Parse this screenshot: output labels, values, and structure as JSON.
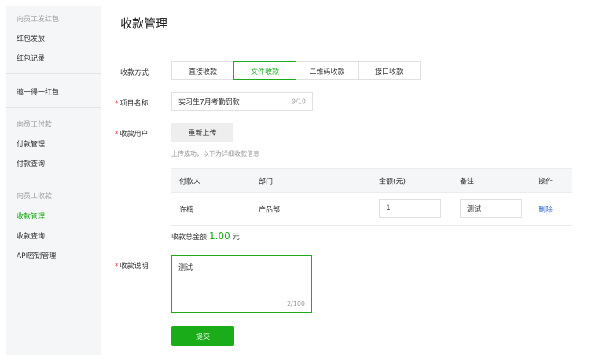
{
  "sidebar": {
    "groups": [
      {
        "title": "向员工发红包",
        "items": [
          "红包发放",
          "红包记录"
        ]
      },
      {
        "title": "",
        "items": [
          "邀一得一红包"
        ]
      },
      {
        "title": "向员工付款",
        "items": [
          "付款管理",
          "付款查询"
        ]
      },
      {
        "title": "向员工收款",
        "items": [
          "收款管理",
          "收款查询",
          "API密钥管理"
        ]
      }
    ]
  },
  "page": {
    "title": "收款管理"
  },
  "form": {
    "method_label": "收款方式",
    "tabs": [
      "直接收款",
      "文件收款",
      "二维码收款",
      "接口收款"
    ],
    "active_tab": "文件收款",
    "project_label": "项目名称",
    "project_value": "实习生7月考勤罚款",
    "project_counter": "9/10",
    "users_label": "收款用户",
    "reupload_label": "重新上传",
    "upload_tip": "上传成功，以下为详细收款信息",
    "table": {
      "headers": [
        "付款人",
        "部门",
        "金额(元)",
        "备注",
        "操作"
      ],
      "rows": [
        {
          "payer": "许楠",
          "dept": "产品部",
          "amount": "1",
          "note": "测试",
          "action": "删除"
        }
      ]
    },
    "total_label": "收款总金额",
    "total_amount": "1.00",
    "total_unit": "元",
    "desc_label": "收款说明",
    "desc_value": "测试",
    "desc_counter": "2/100",
    "submit_label": "提交"
  },
  "colors": {
    "accent": "#1aad19",
    "link": "#3b6fd6",
    "required": "#e64340"
  }
}
